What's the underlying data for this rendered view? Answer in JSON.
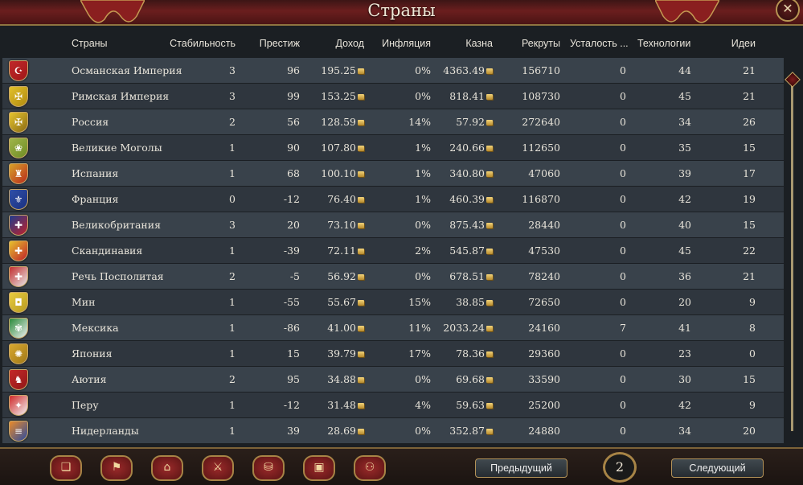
{
  "window": {
    "title": "Страны",
    "close_label": "✕"
  },
  "columns": {
    "country": "Страны",
    "stability": "Стабильность",
    "prestige": "Престиж",
    "income": "Доход",
    "inflation": "Инфляция",
    "treasury": "Казна",
    "manpower": "Рекруты",
    "war_exhaustion": "Усталость ...",
    "technology": "Технологии",
    "ideas": "Идеи"
  },
  "rows": [
    {
      "name": "Османская Империя",
      "stability": "3",
      "prestige": "96",
      "income": "195.25",
      "inflation": "0%",
      "treasury": "4363.49",
      "manpower": "156710",
      "war_exhaustion": "0",
      "technology": "44",
      "ideas": "21",
      "flag_colors": [
        "#c0282a",
        "#a01818"
      ],
      "flag_symbol": "☪",
      "flag_icon": "crescent-icon"
    },
    {
      "name": "Римская Империя",
      "stability": "3",
      "prestige": "99",
      "income": "153.25",
      "inflation": "0%",
      "treasury": "818.41",
      "manpower": "108730",
      "war_exhaustion": "0",
      "technology": "45",
      "ideas": "21",
      "flag_colors": [
        "#e2c02a",
        "#b08a10"
      ],
      "flag_symbol": "✠",
      "flag_icon": "eagle-icon"
    },
    {
      "name": "Россия",
      "stability": "2",
      "prestige": "56",
      "income": "128.59",
      "inflation": "14%",
      "treasury": "57.92",
      "manpower": "272640",
      "war_exhaustion": "0",
      "technology": "34",
      "ideas": "26",
      "flag_colors": [
        "#e6c52e",
        "#8a6a14"
      ],
      "flag_symbol": "✠",
      "flag_icon": "eagle-icon"
    },
    {
      "name": "Великие Моголы",
      "stability": "1",
      "prestige": "90",
      "income": "107.80",
      "inflation": "1%",
      "treasury": "240.66",
      "manpower": "112650",
      "war_exhaustion": "0",
      "technology": "35",
      "ideas": "15",
      "flag_colors": [
        "#9fb54a",
        "#6f8c24"
      ],
      "flag_symbol": "❀",
      "flag_icon": "mughal-icon"
    },
    {
      "name": "Испания",
      "stability": "1",
      "prestige": "68",
      "income": "100.10",
      "inflation": "1%",
      "treasury": "340.80",
      "manpower": "47060",
      "war_exhaustion": "0",
      "technology": "39",
      "ideas": "17",
      "flag_colors": [
        "#d8a22a",
        "#b82a1c"
      ],
      "flag_symbol": "♜",
      "flag_icon": "castle-icon"
    },
    {
      "name": "Франция",
      "stability": "0",
      "prestige": "-12",
      "income": "76.40",
      "inflation": "1%",
      "treasury": "460.39",
      "manpower": "116870",
      "war_exhaustion": "0",
      "technology": "42",
      "ideas": "19",
      "flag_colors": [
        "#2f4fa8",
        "#1a3080"
      ],
      "flag_symbol": "⚜",
      "flag_icon": "fleur-de-lis-icon"
    },
    {
      "name": "Великобритания",
      "stability": "3",
      "prestige": "20",
      "income": "73.10",
      "inflation": "0%",
      "treasury": "875.43",
      "manpower": "28440",
      "war_exhaustion": "0",
      "technology": "40",
      "ideas": "15",
      "flag_colors": [
        "#203c8c",
        "#c0202a"
      ],
      "flag_symbol": "✚",
      "flag_icon": "union-jack-icon"
    },
    {
      "name": "Скандинавия",
      "stability": "1",
      "prestige": "-39",
      "income": "72.11",
      "inflation": "2%",
      "treasury": "545.87",
      "manpower": "47530",
      "war_exhaustion": "0",
      "technology": "45",
      "ideas": "22",
      "flag_colors": [
        "#e6c02c",
        "#c0202a"
      ],
      "flag_symbol": "✚",
      "flag_icon": "nordic-cross-icon"
    },
    {
      "name": "Речь Посполитая",
      "stability": "2",
      "prestige": "-5",
      "income": "56.92",
      "inflation": "0%",
      "treasury": "678.51",
      "manpower": "78240",
      "war_exhaustion": "0",
      "technology": "36",
      "ideas": "21",
      "flag_colors": [
        "#c23030",
        "#e8e8e8"
      ],
      "flag_symbol": "✚",
      "flag_icon": "commonwealth-icon"
    },
    {
      "name": "Мин",
      "stability": "1",
      "prestige": "-55",
      "income": "55.67",
      "inflation": "15%",
      "treasury": "38.85",
      "manpower": "72650",
      "war_exhaustion": "0",
      "technology": "20",
      "ideas": "9",
      "flag_colors": [
        "#e8cc40",
        "#b89a20"
      ],
      "flag_symbol": "◘",
      "flag_icon": "ming-icon"
    },
    {
      "name": "Мексика",
      "stability": "1",
      "prestige": "-86",
      "income": "41.00",
      "inflation": "11%",
      "treasury": "2033.24",
      "manpower": "24160",
      "war_exhaustion": "7",
      "technology": "41",
      "ideas": "8",
      "flag_colors": [
        "#2a8a3a",
        "#f0f0f0"
      ],
      "flag_symbol": "✾",
      "flag_icon": "mexico-icon"
    },
    {
      "name": "Япония",
      "stability": "1",
      "prestige": "15",
      "income": "39.79",
      "inflation": "17%",
      "treasury": "78.36",
      "manpower": "29360",
      "war_exhaustion": "0",
      "technology": "23",
      "ideas": "0",
      "flag_colors": [
        "#d8a830",
        "#a07818"
      ],
      "flag_symbol": "✺",
      "flag_icon": "chrysanthemum-icon"
    },
    {
      "name": "Аютия",
      "stability": "2",
      "prestige": "95",
      "income": "34.88",
      "inflation": "0%",
      "treasury": "69.68",
      "manpower": "33590",
      "war_exhaustion": "0",
      "technology": "30",
      "ideas": "15",
      "flag_colors": [
        "#c42828",
        "#901818"
      ],
      "flag_symbol": "♞",
      "flag_icon": "elephant-icon"
    },
    {
      "name": "Перу",
      "stability": "1",
      "prestige": "-12",
      "income": "31.48",
      "inflation": "4%",
      "treasury": "59.63",
      "manpower": "25200",
      "war_exhaustion": "0",
      "technology": "42",
      "ideas": "9",
      "flag_colors": [
        "#d02a2a",
        "#f2f2f2"
      ],
      "flag_symbol": "✦",
      "flag_icon": "peru-icon"
    },
    {
      "name": "Нидерланды",
      "stability": "1",
      "prestige": "39",
      "income": "28.69",
      "inflation": "0%",
      "treasury": "352.87",
      "manpower": "24880",
      "war_exhaustion": "0",
      "technology": "34",
      "ideas": "20",
      "flag_colors": [
        "#e88a2a",
        "#2a4aa0"
      ],
      "flag_symbol": "≡",
      "flag_icon": "dutch-flag-icon"
    }
  ],
  "toolbar": [
    {
      "name": "ledger-button",
      "icon": "scroll-icon",
      "glyph": "❏"
    },
    {
      "name": "flag-button",
      "icon": "flag-icon",
      "glyph": "⚑"
    },
    {
      "name": "buildings-button",
      "icon": "buildings-icon",
      "glyph": "⌂"
    },
    {
      "name": "military-button",
      "icon": "crossed-swords-icon",
      "glyph": "⚔"
    },
    {
      "name": "economy-button",
      "icon": "coins-icon",
      "glyph": "⛁"
    },
    {
      "name": "trade-button",
      "icon": "crate-icon",
      "glyph": "▣"
    },
    {
      "name": "diplomacy-button",
      "icon": "handshake-icon",
      "glyph": "⚇"
    }
  ],
  "pager": {
    "prev_label": "Предыдущий",
    "next_label": "Следующий",
    "page": "2"
  },
  "colors": {
    "title_bar": "#6b1e1e",
    "row_odd": "#39424b",
    "row_even": "#2f363e",
    "gold_border": "#a78446"
  }
}
